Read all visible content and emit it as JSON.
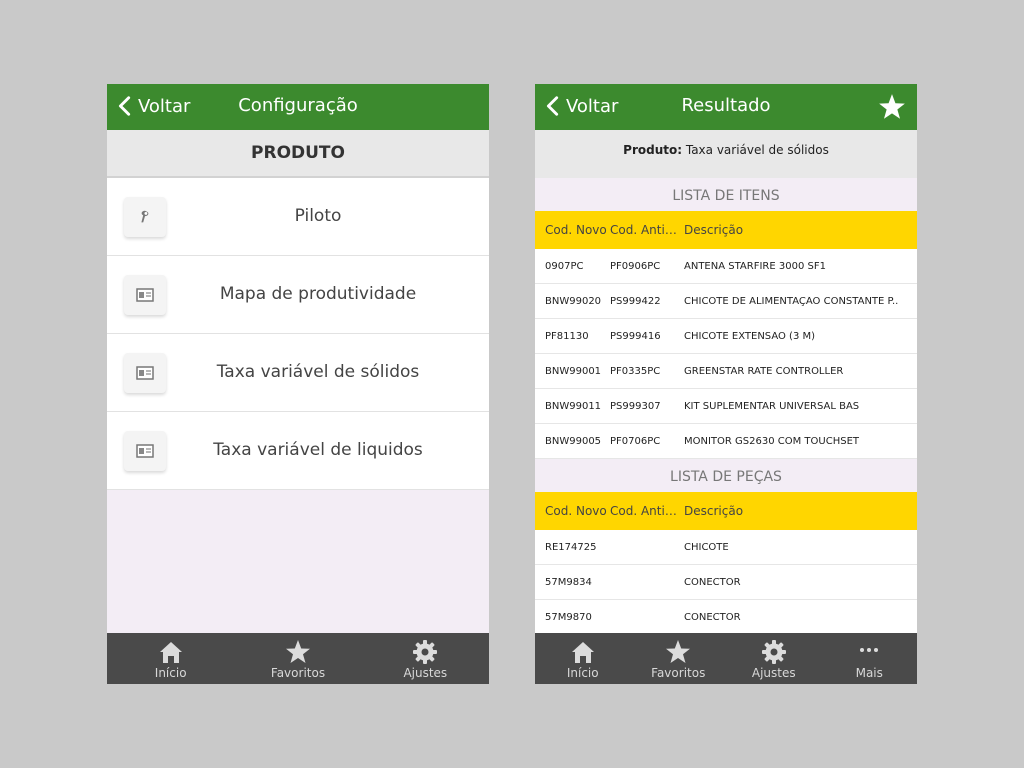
{
  "left": {
    "header": {
      "back_label": "Voltar",
      "title": "Configuração"
    },
    "section_title": "PRODUTO",
    "items": [
      {
        "label": "Piloto",
        "icon": "pilot-icon"
      },
      {
        "label": "Mapa de produtividade",
        "icon": "map-icon"
      },
      {
        "label": "Taxa variável de sólidos",
        "icon": "map-icon"
      },
      {
        "label": "Taxa variável de liquidos",
        "icon": "map-icon"
      }
    ],
    "tabs": [
      {
        "label": "Início",
        "icon": "home-icon"
      },
      {
        "label": "Favoritos",
        "icon": "star-icon"
      },
      {
        "label": "Ajustes",
        "icon": "gear-icon"
      }
    ]
  },
  "right": {
    "header": {
      "back_label": "Voltar",
      "title": "Resultado"
    },
    "product_label": "Produto:",
    "product_value": "Taxa variável de sólidos",
    "items_title": "LISTA DE ITENS",
    "columns": {
      "new_code": "Cod. Novo",
      "old_code": "Cod. Antig..",
      "description": "Descrição"
    },
    "items": [
      {
        "new": "0907PC",
        "old": "PF0906PC",
        "desc": "ANTENA STARFIRE 3000 SF1"
      },
      {
        "new": "BNW99020",
        "old": "PS999422",
        "desc": "CHICOTE DE ALIMENTAÇÃO CONSTANTE P.."
      },
      {
        "new": "PF81130",
        "old": "PS999416",
        "desc": "CHICOTE EXTENSÃO (3 M)"
      },
      {
        "new": "BNW99001",
        "old": "PF0335PC",
        "desc": "GREENSTAR RATE CONTROLLER"
      },
      {
        "new": "BNW99011",
        "old": "PS999307",
        "desc": "KIT SUPLEMENTAR UNIVERSAL BAS"
      },
      {
        "new": "BNW99005",
        "old": "PF0706PC",
        "desc": "MONITOR GS2630 COM TOUCHSET"
      }
    ],
    "parts_title": "LISTA DE PEÇAS",
    "parts": [
      {
        "new": "RE174725",
        "old": "",
        "desc": "CHICOTE"
      },
      {
        "new": "57M9834",
        "old": "",
        "desc": "CONECTOR"
      },
      {
        "new": "57M9870",
        "old": "",
        "desc": "CONECTOR"
      }
    ],
    "tabs": [
      {
        "label": "Início",
        "icon": "home-icon"
      },
      {
        "label": "Favoritos",
        "icon": "star-icon"
      },
      {
        "label": "Ajustes",
        "icon": "gear-icon"
      },
      {
        "label": "Mais",
        "icon": "more-icon"
      }
    ]
  },
  "colors": {
    "header_green": "#3c8a2e",
    "column_yellow": "#ffd600",
    "tabbar": "#4a4a4a"
  }
}
